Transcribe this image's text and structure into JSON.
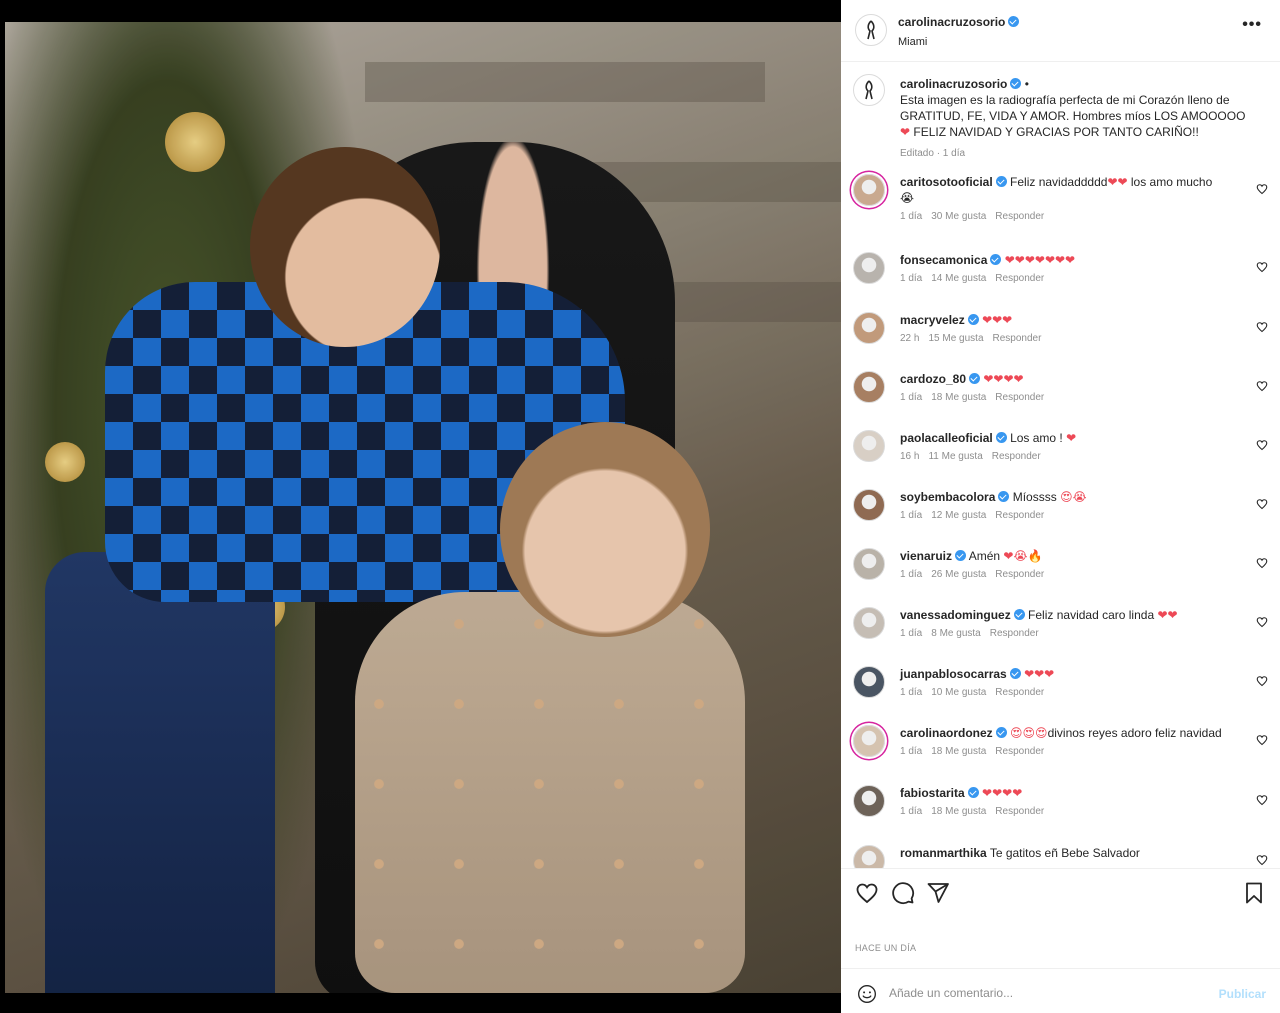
{
  "post": {
    "username": "carolinacruzosorio",
    "location": "Miami",
    "more_label": "•••"
  },
  "caption": {
    "username": "carolinacruzosorio",
    "dot": "•",
    "text_line1": "Esta imagen es la radiografía perfecta de mi Corazón lleno de",
    "text_line2": "GRATITUD, FE, VIDA Y AMOR. Hombres míos LOS AMOOOOO",
    "hearts": "❤",
    "text_line3": " FELIZ NAVIDAD Y GRACIAS POR TANTO CARIÑO!!",
    "meta": "Editado · 1 día"
  },
  "comments": [
    {
      "username": "caritosotooficial",
      "text": "Feliz navidaddddd",
      "emoji": "❤❤",
      "text_after": " los amo mucho",
      "line2": "😭",
      "time": "1 día",
      "likes": "30 Me gusta",
      "reply": "Responder"
    },
    {
      "username": "fonsecamonica",
      "text": "",
      "emoji": "❤❤❤❤❤❤❤",
      "text_after": "",
      "line2": "",
      "time": "1 día",
      "likes": "14 Me gusta",
      "reply": "Responder"
    },
    {
      "username": "macryvelez",
      "text": "",
      "emoji": "❤❤❤",
      "text_after": "",
      "line2": "",
      "time": "22 h",
      "likes": "15 Me gusta",
      "reply": "Responder"
    },
    {
      "username": "cardozo_80",
      "text": "",
      "emoji": "❤❤❤❤",
      "text_after": "",
      "line2": "",
      "time": "1 día",
      "likes": "18 Me gusta",
      "reply": "Responder"
    },
    {
      "username": "paolacalleoficial",
      "text": "Los amo ! ",
      "emoji": "❤",
      "text_after": "",
      "line2": "",
      "time": "16 h",
      "likes": "11 Me gusta",
      "reply": "Responder"
    },
    {
      "username": "soybembacolora",
      "text": "Míossss ",
      "emoji": "😍😭",
      "text_after": "",
      "line2": "",
      "time": "1 día",
      "likes": "12 Me gusta",
      "reply": "Responder"
    },
    {
      "username": "vienaruiz",
      "text": "Amén ",
      "emoji": "❤😭🔥",
      "text_after": "",
      "line2": "",
      "time": "1 día",
      "likes": "26 Me gusta",
      "reply": "Responder"
    },
    {
      "username": "vanessadominguez",
      "text": "Feliz navidad caro linda ",
      "emoji": "❤❤",
      "text_after": "",
      "line2": "",
      "time": "1 día",
      "likes": "8 Me gusta",
      "reply": "Responder"
    },
    {
      "username": "juanpablosocarras",
      "text": "",
      "emoji": "❤❤❤",
      "text_after": "",
      "line2": "",
      "time": "1 día",
      "likes": "10 Me gusta",
      "reply": "Responder"
    },
    {
      "username": "carolinaordonez",
      "text": "",
      "emoji": "😍😍😍",
      "text_after": "divinos reyes adoro feliz navidad",
      "line2": "",
      "time": "1 día",
      "likes": "18 Me gusta",
      "reply": "Responder"
    },
    {
      "username": "fabiostarita",
      "text": "",
      "emoji": "❤❤❤❤",
      "text_after": "",
      "line2": "",
      "time": "1 día",
      "likes": "18 Me gusta",
      "reply": "Responder"
    },
    {
      "username": "romanmarthika",
      "text": "Te gatitos eñ Bebe Salvador",
      "emoji": "",
      "text_after": "",
      "line2": "",
      "time": "",
      "likes": "",
      "reply": ""
    }
  ],
  "footer": {
    "date": "HACE UN DÍA",
    "comment_placeholder": "Añade un comentario...",
    "publish_label": "Publicar"
  },
  "colors": {
    "verified": "#3897f0",
    "heart": "#ed4956",
    "publish_disabled": "#b2dffc"
  }
}
